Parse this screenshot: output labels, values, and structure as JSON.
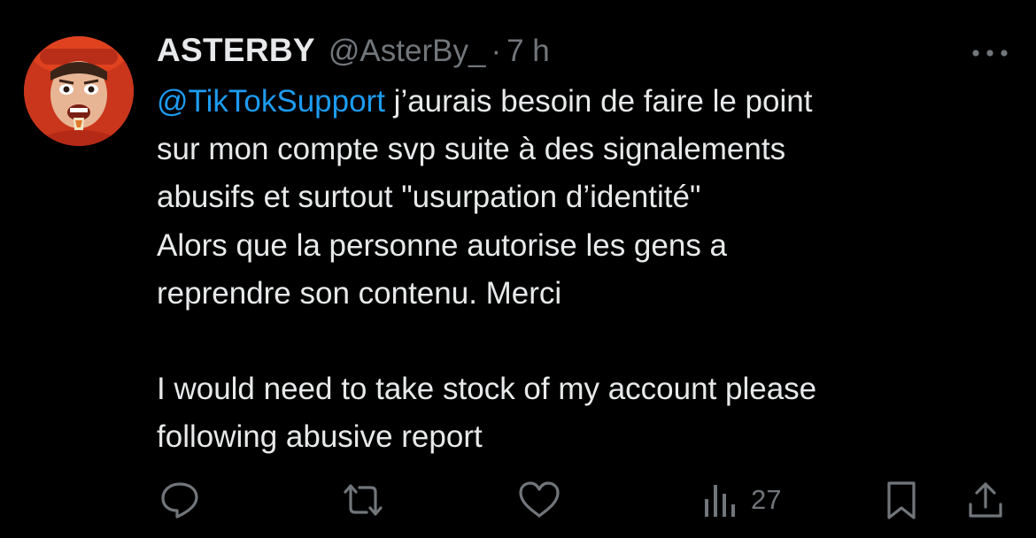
{
  "tweet": {
    "author": {
      "display_name": "ASTERBY",
      "handle": "@AsterBy_",
      "separator": "·",
      "time": "7 h"
    },
    "body": {
      "mention": "@TikTokSupport",
      "line1_rest": " j’aurais besoin de faire le point",
      "line2": "sur mon compte svp suite à des signalements",
      "line3": "abusifs et surtout \"usurpation d’identité\"",
      "line4": "Alors que la personne autorise les gens a",
      "line5": "reprendre son contenu. Merci",
      "line6": "I would need to take stock of my account please",
      "line7": "following abusive report"
    },
    "actions": {
      "views_count": "27",
      "icons": [
        "reply-icon",
        "retweet-icon",
        "like-icon",
        "views-icon",
        "bookmark-icon",
        "share-icon"
      ]
    },
    "colors": {
      "background": "#000000",
      "text": "#e7e9ea",
      "secondary": "#71767b",
      "link": "#1d9bf0"
    }
  }
}
